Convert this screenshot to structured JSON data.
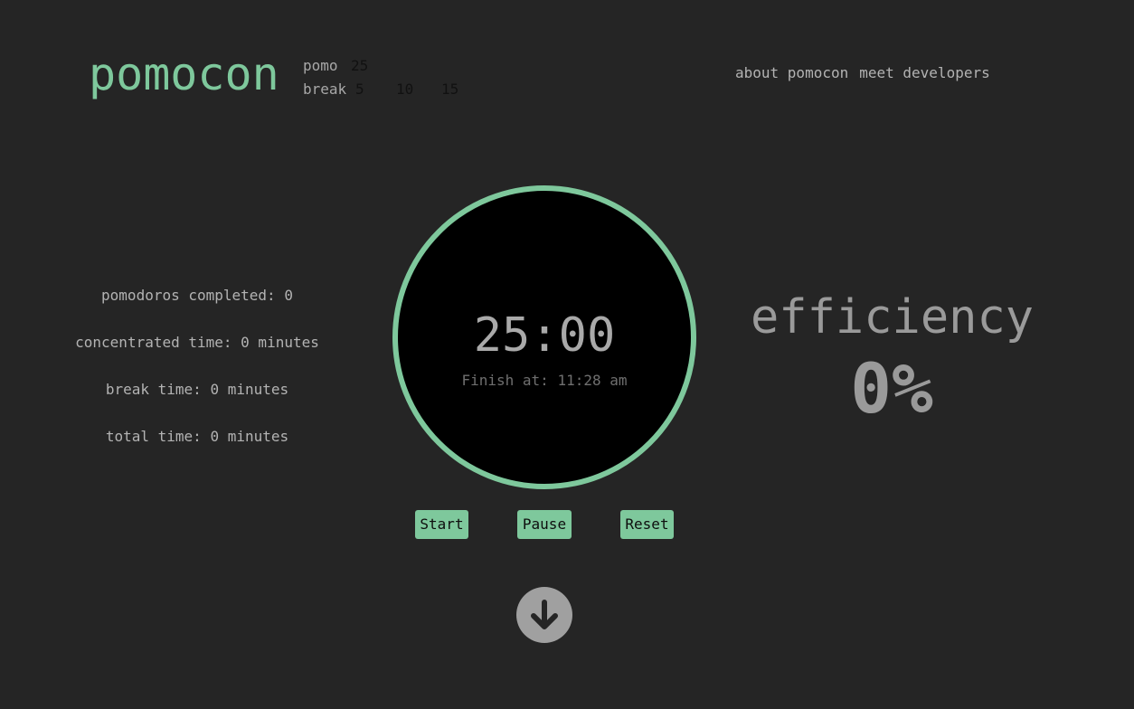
{
  "app": {
    "logo": "pomocon"
  },
  "durations": {
    "pomo_label": "pomo",
    "pomo_options": [
      "25"
    ],
    "break_label": "break",
    "break_options": [
      "5",
      "10",
      "15"
    ]
  },
  "nav": {
    "about": "about pomocon",
    "developers": "meet developers"
  },
  "stats": {
    "pomodoros": "pomodoros completed: 0",
    "concentrated": "concentrated time: 0 minutes",
    "break": "break time: 0 minutes",
    "total": "total time: 0 minutes"
  },
  "timer": {
    "time": "25:00",
    "finish": "Finish at: 11:28 am"
  },
  "controls": {
    "start": "Start",
    "pause": "Pause",
    "reset": "Reset"
  },
  "efficiency": {
    "title": "efficiency",
    "value": "0%"
  },
  "icons": {
    "scroll": "arrow-down-circle-icon"
  },
  "colors": {
    "background": "#252525",
    "accent": "#7ec89c",
    "timer_face": "#000000",
    "text": "#b3b3b3"
  }
}
